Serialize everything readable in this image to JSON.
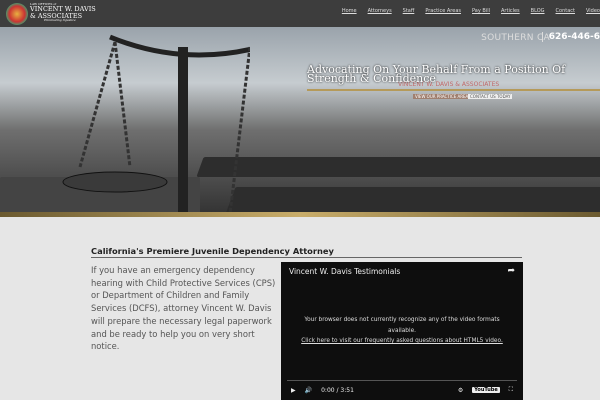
{
  "header": {
    "brand_small": "LAW OFFICES of",
    "brand_name": "VINCENT W. DAVIS",
    "brand_name2": "& ASSOCIATES",
    "tagline": "Eliminating Injustice",
    "nav": [
      "Home",
      "Attorneys",
      "Staff",
      "Practice Areas",
      "Pay Bill",
      "Articles",
      "BLOG",
      "Contact",
      "Video"
    ]
  },
  "hero": {
    "region": "SOUTHERN CA",
    "phone": "626-446-6",
    "slogan": "Advocating On Your Behalf From a Position Of Strength & Confidence",
    "sub": "VINCENT W. DAVIS & ASSOCIATES",
    "btn1": "VIEW OUR PRACTICE AREAS",
    "btn2": "CONTACT US TODAY"
  },
  "main": {
    "heading": "California's Premiere Juvenile Dependency Attorney",
    "intro": "If you have an emergency dependency hearing with Child Protective Services (CPS) or Department of Children and Family Services (DCFS), attorney Vincent W. Davis will prepare the necessary legal paperwork and be ready to help you on very short notice."
  },
  "video": {
    "title": "Vincent W. Davis Testimonials",
    "message": "Your browser does not currently recognize any of the video formats available.",
    "link": "Click here to visit our frequently asked questions about HTML5 video.",
    "time": "0:00 / 3:51",
    "youtube": "YouTube"
  }
}
